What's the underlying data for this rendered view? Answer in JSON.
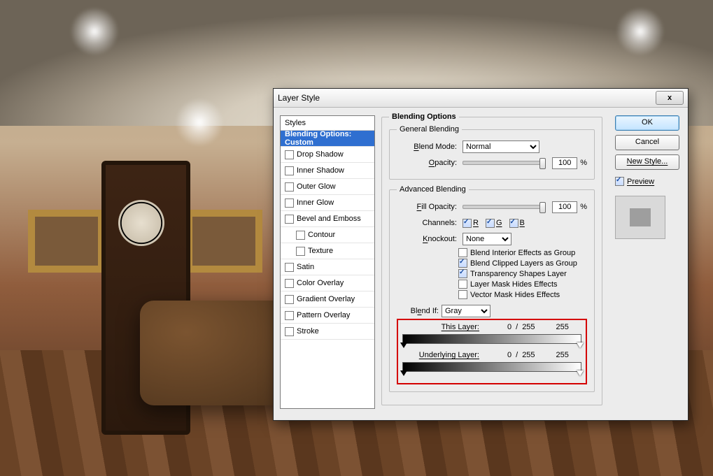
{
  "dialog": {
    "title": "Layer Style",
    "close_glyph": "x"
  },
  "buttons": {
    "ok": "OK",
    "cancel": "Cancel",
    "new_style": "New Style...",
    "preview_label": "Preview",
    "preview_checked": true
  },
  "styles_list": {
    "header": "Styles",
    "items": [
      {
        "label": "Blending Options: Custom",
        "selected": true,
        "checkbox": false
      },
      {
        "label": "Drop Shadow",
        "checked": false
      },
      {
        "label": "Inner Shadow",
        "checked": false
      },
      {
        "label": "Outer Glow",
        "checked": false
      },
      {
        "label": "Inner Glow",
        "checked": false
      },
      {
        "label": "Bevel and Emboss",
        "checked": false
      },
      {
        "label": "Contour",
        "checked": false,
        "sub": true
      },
      {
        "label": "Texture",
        "checked": false,
        "sub": true
      },
      {
        "label": "Satin",
        "checked": false
      },
      {
        "label": "Color Overlay",
        "checked": false
      },
      {
        "label": "Gradient Overlay",
        "checked": false
      },
      {
        "label": "Pattern Overlay",
        "checked": false
      },
      {
        "label": "Stroke",
        "checked": false
      }
    ]
  },
  "blending": {
    "section_title": "Blending Options",
    "general": {
      "legend": "General Blending",
      "blend_mode_label": "Blend Mode:",
      "blend_mode_value": "Normal",
      "opacity_label": "Opacity:",
      "opacity_value": "100",
      "opacity_unit": "%"
    },
    "advanced": {
      "legend": "Advanced Blending",
      "fill_opacity_label": "Fill Opacity:",
      "fill_opacity_value": "100",
      "fill_opacity_unit": "%",
      "channels_label": "Channels:",
      "channels": {
        "R": true,
        "G": true,
        "B": true
      },
      "knockout_label": "Knockout:",
      "knockout_value": "None",
      "opts": {
        "interior": {
          "label": "Blend Interior Effects as Group",
          "checked": false
        },
        "clipped": {
          "label": "Blend Clipped Layers as Group",
          "checked": true
        },
        "transparency": {
          "label": "Transparency Shapes Layer",
          "checked": true
        },
        "layer_mask": {
          "label": "Layer Mask Hides Effects",
          "checked": false
        },
        "vector_mask": {
          "label": "Vector Mask Hides Effects",
          "checked": false
        }
      }
    },
    "blend_if": {
      "label": "Blend If:",
      "value": "Gray",
      "this_layer": {
        "label": "This Layer:",
        "low": "0",
        "sep": "/",
        "high_split": "255",
        "high": "255"
      },
      "underlying": {
        "label": "Underlying Layer:",
        "low": "0",
        "sep": "/",
        "high_split": "255",
        "high": "255"
      }
    }
  }
}
